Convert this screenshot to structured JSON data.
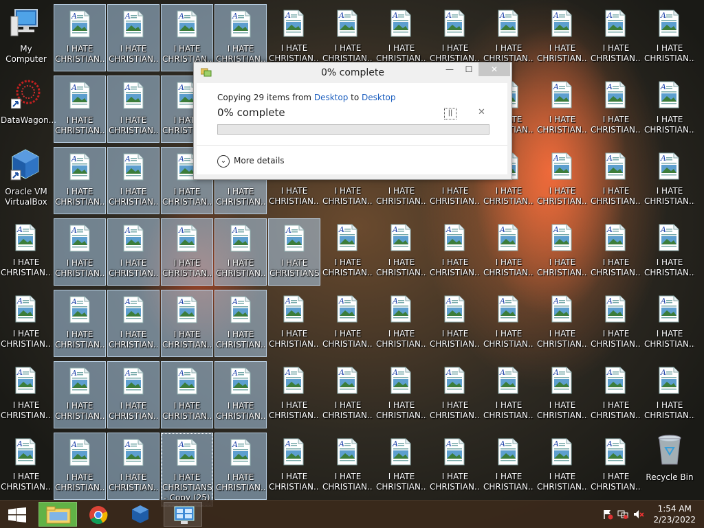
{
  "desktop": {
    "system_icons": [
      {
        "id": "my-computer",
        "label": "My Computer"
      },
      {
        "id": "datawagon",
        "label": "DataWagon..."
      },
      {
        "id": "virtualbox",
        "label": "Oracle VM VirtualBox"
      },
      {
        "id": "recycle-bin",
        "label": "Recycle Bin"
      }
    ],
    "file_label_line1": "I HATE",
    "file_label_line2": "CHRISTIAN...",
    "full_label_line2": "CHRISTIANS",
    "copy_label_line3": "- Copy (25)",
    "copy_label_line2": "CHRISTIANS"
  },
  "dialog": {
    "title": "0% complete",
    "copying_prefix": "Copying 29 items from",
    "source": "Desktop",
    "to": "to",
    "destination": "Desktop",
    "percent_text": "0% complete",
    "progress": 0,
    "more_details": "More details",
    "minimize": "—",
    "maximize": "☐",
    "close": "✕",
    "pause": "||",
    "cancel": "✕"
  },
  "taskbar": {
    "time": "1:54 AM",
    "date": "2/23/2022"
  }
}
